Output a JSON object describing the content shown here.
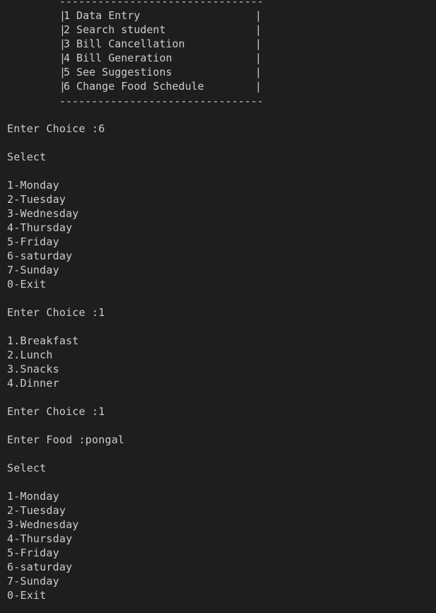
{
  "colors": {
    "background": "#1e1e1e",
    "text": "#cccccc"
  },
  "menu": {
    "border": "--------------------------------",
    "bar": "|",
    "items": [
      {
        "label": "1 Data Entry"
      },
      {
        "label": "2 Search student"
      },
      {
        "label": "3 Bill Cancellation"
      },
      {
        "label": "4 Bill Generation"
      },
      {
        "label": "5 See Suggestions"
      },
      {
        "label": "6 Change Food Schedule"
      }
    ]
  },
  "output": {
    "choice_1": "Enter Choice :6",
    "select_1": "Select",
    "days_1": [
      "1-Monday",
      "2-Tuesday",
      "3-Wednesday",
      "4-Thursday",
      "5-Friday",
      "6-saturday",
      "7-Sunday",
      "0-Exit"
    ],
    "choice_2": "Enter Choice :1",
    "meals": [
      "1.Breakfast",
      "2.Lunch",
      "3.Snacks",
      "4.Dinner"
    ],
    "choice_3": "Enter Choice :1",
    "food": "Enter Food :pongal",
    "select_2": "Select",
    "days_2": [
      "1-Monday",
      "2-Tuesday",
      "3-Wednesday",
      "4-Thursday",
      "5-Friday",
      "6-saturday",
      "7-Sunday",
      "0-Exit"
    ]
  }
}
